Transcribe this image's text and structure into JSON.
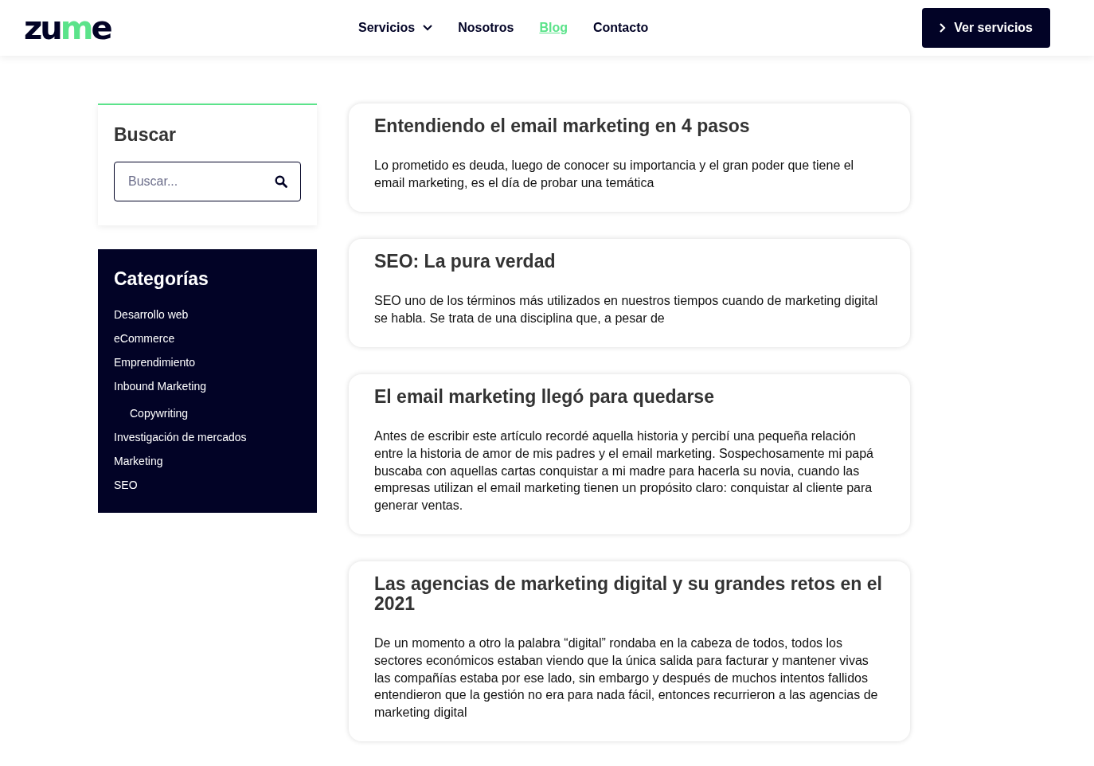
{
  "logo": [
    {
      "text": "zu",
      "accent": false
    },
    {
      "text": "m",
      "accent": true
    },
    {
      "text": "e",
      "accent": false
    }
  ],
  "nav": [
    {
      "label": "Servicios",
      "selected": false,
      "dropdown": true
    },
    {
      "label": "Nosotros",
      "selected": false,
      "dropdown": false
    },
    {
      "label": "Blog",
      "selected": true,
      "dropdown": false
    },
    {
      "label": "Contacto",
      "selected": false,
      "dropdown": false
    }
  ],
  "cta": {
    "label": "Ver servicios"
  },
  "search_widget": {
    "title": "Buscar",
    "placeholder": "Buscar..."
  },
  "categories": {
    "title": "Categorías",
    "items": [
      {
        "label": "Desarrollo web"
      },
      {
        "label": "eCommerce"
      },
      {
        "label": "Emprendimiento"
      },
      {
        "label": "Inbound Marketing",
        "children": [
          {
            "label": "Copywriting"
          }
        ]
      },
      {
        "label": "Investigación de mercados"
      },
      {
        "label": "Marketing"
      },
      {
        "label": "SEO"
      }
    ]
  },
  "posts": [
    {
      "title": "Entendiendo el email marketing en 4 pasos",
      "excerpt": "Lo prometido es deuda, luego de conocer su importancia y el gran poder que tiene el email marketing, es el día de probar una temática"
    },
    {
      "title": "SEO: La pura verdad",
      "excerpt": "SEO uno de los términos más utilizados en nuestros tiempos cuando de marketing digital se habla. Se trata de una disciplina que, a pesar de"
    },
    {
      "title": "El email marketing llegó para quedarse",
      "excerpt": "Antes de escribir este artículo recordé aquella historia y percibí una pequeña relación entre la historia de amor de mis padres y el email marketing. Sospechosamente mi papá buscaba con aquellas cartas conquistar a mi madre para hacerla su novia, cuando las empresas utilizan el email marketing tienen un propósito claro: conquistar al cliente para generar ventas."
    },
    {
      "title": "Las agencias de marketing digital y su grandes retos en el 2021",
      "excerpt": "De un momento a otro la palabra “digital” rondaba en la cabeza de todos, todos los sectores económicos estaban viendo que la única salida para facturar y mantener vivas las compañías estaba por ese lado, sin embargo y después de muchos intentos fallidos entendieron que la gestión no era para nada fácil, entonces recurrieron a las agencias de marketing digital"
    }
  ]
}
